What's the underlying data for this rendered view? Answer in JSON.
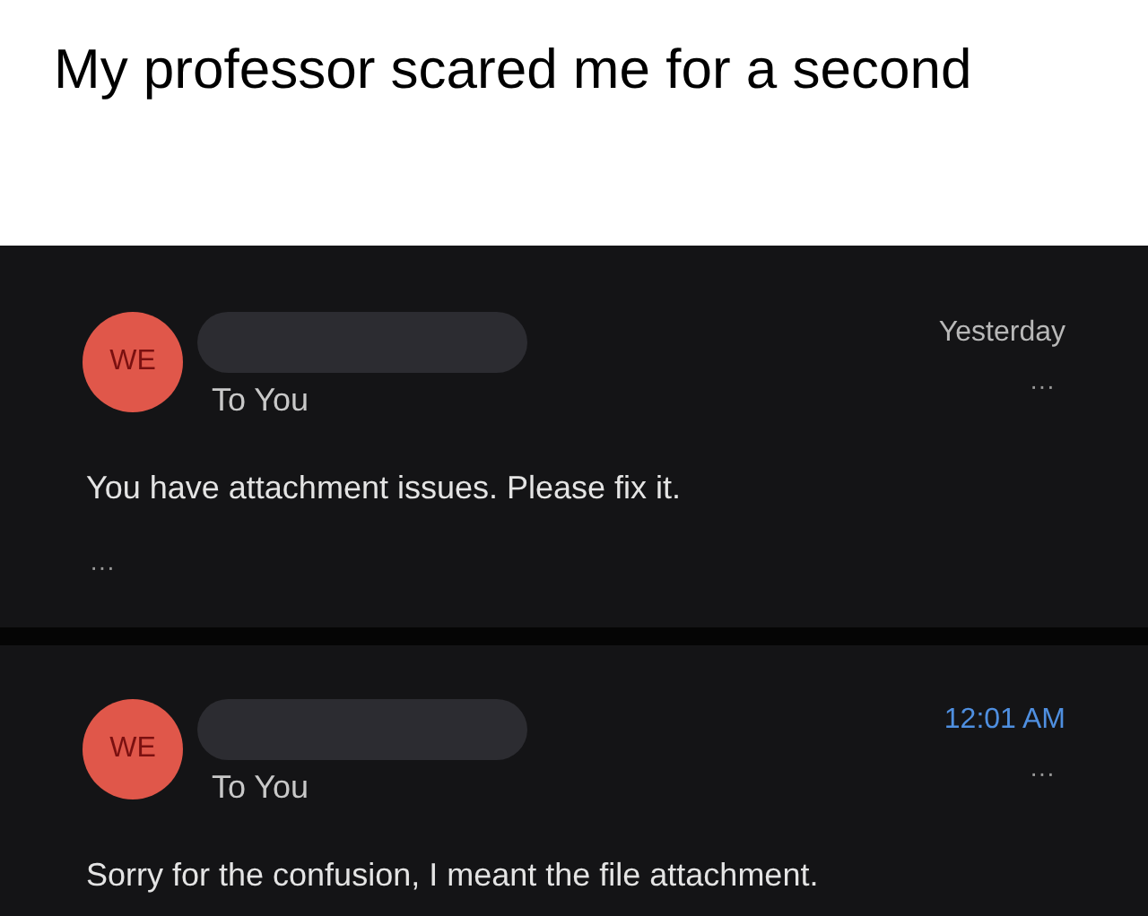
{
  "caption": "My professor scared me for a second",
  "emails": [
    {
      "avatar": "WE",
      "recipient": "To You",
      "time": "Yesterday",
      "unread": false,
      "menu": "···",
      "body": "You have attachment issues. Please fix it.",
      "expand": "···"
    },
    {
      "avatar": "WE",
      "recipient": "To You",
      "time": "12:01 AM",
      "unread": true,
      "menu": "···",
      "body": "Sorry for the confusion, I meant the file attachment."
    }
  ]
}
